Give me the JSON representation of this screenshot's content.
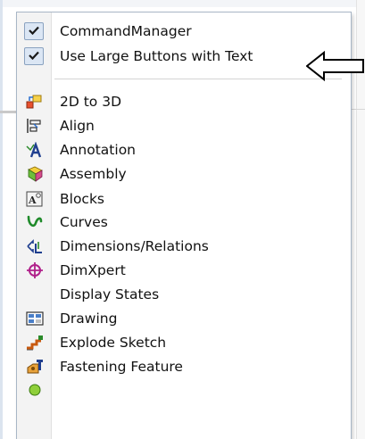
{
  "menu": {
    "checked_items": [
      {
        "label": "CommandManager",
        "checked": true
      },
      {
        "label": "Use Large Buttons with Text",
        "checked": true
      }
    ],
    "toolbar_items": [
      {
        "label": "2D to 3D",
        "icon": "2d-to-3d-icon"
      },
      {
        "label": "Align",
        "icon": "align-icon"
      },
      {
        "label": "Annotation",
        "icon": "annotation-icon"
      },
      {
        "label": "Assembly",
        "icon": "assembly-icon"
      },
      {
        "label": "Blocks",
        "icon": "blocks-icon"
      },
      {
        "label": "Curves",
        "icon": "curves-icon"
      },
      {
        "label": "Dimensions/Relations",
        "icon": "dimensions-relations-icon"
      },
      {
        "label": "DimXpert",
        "icon": "dimxpert-icon"
      },
      {
        "label": "Display States",
        "icon": ""
      },
      {
        "label": "Drawing",
        "icon": "drawing-icon"
      },
      {
        "label": "Explode Sketch",
        "icon": "explode-sketch-icon"
      },
      {
        "label": "Fastening Feature",
        "icon": "fastening-feature-icon"
      }
    ]
  },
  "colors": {
    "menu_border": "#a8b6c6",
    "check_fill": "#dbe6f4",
    "gutter": "#f3f3f3"
  }
}
